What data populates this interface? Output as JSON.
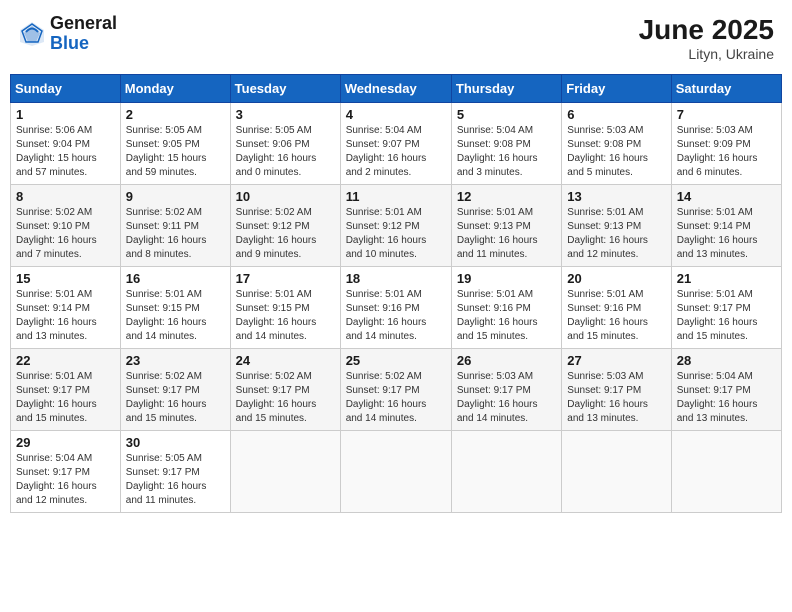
{
  "header": {
    "logo_general": "General",
    "logo_blue": "Blue",
    "month_title": "June 2025",
    "location": "Lityn, Ukraine"
  },
  "weekdays": [
    "Sunday",
    "Monday",
    "Tuesday",
    "Wednesday",
    "Thursday",
    "Friday",
    "Saturday"
  ],
  "weeks": [
    [
      {
        "day": "1",
        "content": "Sunrise: 5:06 AM\nSunset: 9:04 PM\nDaylight: 15 hours\nand 57 minutes."
      },
      {
        "day": "2",
        "content": "Sunrise: 5:05 AM\nSunset: 9:05 PM\nDaylight: 15 hours\nand 59 minutes."
      },
      {
        "day": "3",
        "content": "Sunrise: 5:05 AM\nSunset: 9:06 PM\nDaylight: 16 hours\nand 0 minutes."
      },
      {
        "day": "4",
        "content": "Sunrise: 5:04 AM\nSunset: 9:07 PM\nDaylight: 16 hours\nand 2 minutes."
      },
      {
        "day": "5",
        "content": "Sunrise: 5:04 AM\nSunset: 9:08 PM\nDaylight: 16 hours\nand 3 minutes."
      },
      {
        "day": "6",
        "content": "Sunrise: 5:03 AM\nSunset: 9:08 PM\nDaylight: 16 hours\nand 5 minutes."
      },
      {
        "day": "7",
        "content": "Sunrise: 5:03 AM\nSunset: 9:09 PM\nDaylight: 16 hours\nand 6 minutes."
      }
    ],
    [
      {
        "day": "8",
        "content": "Sunrise: 5:02 AM\nSunset: 9:10 PM\nDaylight: 16 hours\nand 7 minutes."
      },
      {
        "day": "9",
        "content": "Sunrise: 5:02 AM\nSunset: 9:11 PM\nDaylight: 16 hours\nand 8 minutes."
      },
      {
        "day": "10",
        "content": "Sunrise: 5:02 AM\nSunset: 9:12 PM\nDaylight: 16 hours\nand 9 minutes."
      },
      {
        "day": "11",
        "content": "Sunrise: 5:01 AM\nSunset: 9:12 PM\nDaylight: 16 hours\nand 10 minutes."
      },
      {
        "day": "12",
        "content": "Sunrise: 5:01 AM\nSunset: 9:13 PM\nDaylight: 16 hours\nand 11 minutes."
      },
      {
        "day": "13",
        "content": "Sunrise: 5:01 AM\nSunset: 9:13 PM\nDaylight: 16 hours\nand 12 minutes."
      },
      {
        "day": "14",
        "content": "Sunrise: 5:01 AM\nSunset: 9:14 PM\nDaylight: 16 hours\nand 13 minutes."
      }
    ],
    [
      {
        "day": "15",
        "content": "Sunrise: 5:01 AM\nSunset: 9:14 PM\nDaylight: 16 hours\nand 13 minutes."
      },
      {
        "day": "16",
        "content": "Sunrise: 5:01 AM\nSunset: 9:15 PM\nDaylight: 16 hours\nand 14 minutes."
      },
      {
        "day": "17",
        "content": "Sunrise: 5:01 AM\nSunset: 9:15 PM\nDaylight: 16 hours\nand 14 minutes."
      },
      {
        "day": "18",
        "content": "Sunrise: 5:01 AM\nSunset: 9:16 PM\nDaylight: 16 hours\nand 14 minutes."
      },
      {
        "day": "19",
        "content": "Sunrise: 5:01 AM\nSunset: 9:16 PM\nDaylight: 16 hours\nand 15 minutes."
      },
      {
        "day": "20",
        "content": "Sunrise: 5:01 AM\nSunset: 9:16 PM\nDaylight: 16 hours\nand 15 minutes."
      },
      {
        "day": "21",
        "content": "Sunrise: 5:01 AM\nSunset: 9:17 PM\nDaylight: 16 hours\nand 15 minutes."
      }
    ],
    [
      {
        "day": "22",
        "content": "Sunrise: 5:01 AM\nSunset: 9:17 PM\nDaylight: 16 hours\nand 15 minutes."
      },
      {
        "day": "23",
        "content": "Sunrise: 5:02 AM\nSunset: 9:17 PM\nDaylight: 16 hours\nand 15 minutes."
      },
      {
        "day": "24",
        "content": "Sunrise: 5:02 AM\nSunset: 9:17 PM\nDaylight: 16 hours\nand 15 minutes."
      },
      {
        "day": "25",
        "content": "Sunrise: 5:02 AM\nSunset: 9:17 PM\nDaylight: 16 hours\nand 14 minutes."
      },
      {
        "day": "26",
        "content": "Sunrise: 5:03 AM\nSunset: 9:17 PM\nDaylight: 16 hours\nand 14 minutes."
      },
      {
        "day": "27",
        "content": "Sunrise: 5:03 AM\nSunset: 9:17 PM\nDaylight: 16 hours\nand 13 minutes."
      },
      {
        "day": "28",
        "content": "Sunrise: 5:04 AM\nSunset: 9:17 PM\nDaylight: 16 hours\nand 13 minutes."
      }
    ],
    [
      {
        "day": "29",
        "content": "Sunrise: 5:04 AM\nSunset: 9:17 PM\nDaylight: 16 hours\nand 12 minutes."
      },
      {
        "day": "30",
        "content": "Sunrise: 5:05 AM\nSunset: 9:17 PM\nDaylight: 16 hours\nand 11 minutes."
      },
      {
        "day": "",
        "content": ""
      },
      {
        "day": "",
        "content": ""
      },
      {
        "day": "",
        "content": ""
      },
      {
        "day": "",
        "content": ""
      },
      {
        "day": "",
        "content": ""
      }
    ]
  ]
}
